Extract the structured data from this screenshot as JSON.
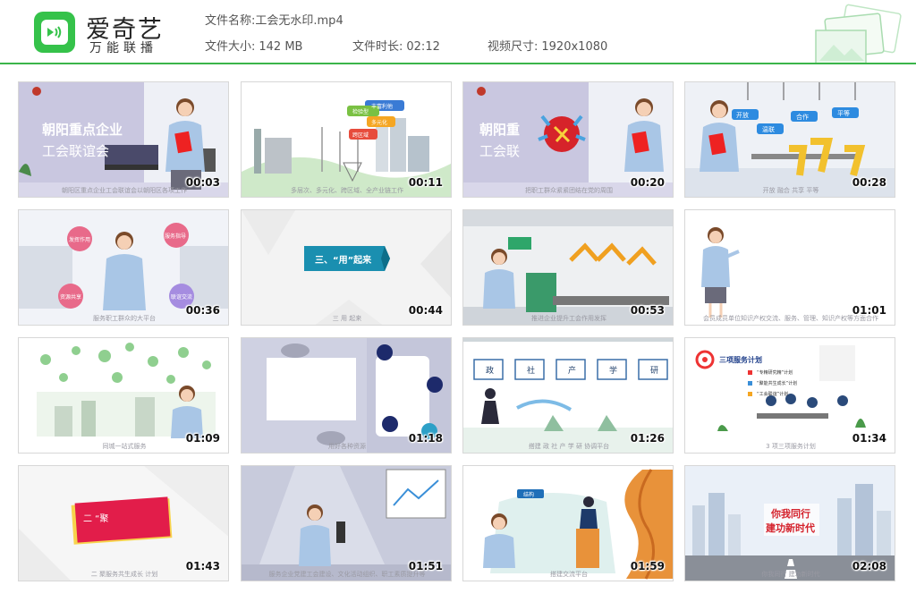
{
  "brand": {
    "name": "爱奇艺",
    "sub": "万能联播",
    "colors": {
      "accent": "#3bb54a",
      "logo": "#35c24a"
    }
  },
  "file": {
    "name_label": "文件名称:",
    "name_value": "工会无水印.mp4",
    "size_label": "文件大小:",
    "size_value": "142 MB",
    "duration_label": "文件时长:",
    "duration_value": "02:12",
    "dims_label": "视频尺寸:",
    "dims_value": "1920x1080"
  },
  "thumbs": [
    {
      "time": "00:03",
      "caption": "朝阳区重点企业工会联谊会以朝阳区各项工作",
      "texts": [
        "朝阳重点企业",
        "工会联谊会"
      ]
    },
    {
      "time": "00:11",
      "caption": "多层次、多元化、跨区域、全产业链工作",
      "texts": [
        "丰富利他",
        "检验型",
        "多元化",
        "跨区域"
      ]
    },
    {
      "time": "00:20",
      "caption": "把职工群众紧紧团结在党的周围",
      "texts": [
        "朝阳重",
        "工会联"
      ]
    },
    {
      "time": "00:28",
      "caption": "开放 融合 共享 平等",
      "texts": [
        "开放",
        "合作",
        "平等",
        "温联"
      ]
    },
    {
      "time": "00:36",
      "caption": "服务职工群众的大平台",
      "texts": [
        "发挥作用",
        "服务指导",
        "资源共享",
        "联谊交流"
      ]
    },
    {
      "time": "00:44",
      "caption": "三 用 起来",
      "texts": [
        "三、“用”起来"
      ]
    },
    {
      "time": "00:53",
      "caption": "推进企业提升工会作用发挥",
      "texts": []
    },
    {
      "time": "01:01",
      "caption": "会员成员单位知识产权交流、服务、管理、知识产权等方面合作",
      "texts": []
    },
    {
      "time": "01:09",
      "caption": "同城一站式服务",
      "texts": []
    },
    {
      "time": "01:18",
      "caption": "用好各种资源",
      "texts": []
    },
    {
      "time": "01:26",
      "caption": "搭建 政 社 产 学 研 协调平台",
      "texts": [
        "政",
        "社",
        "产",
        "学",
        "研"
      ]
    },
    {
      "time": "01:34",
      "caption": "3 项三项服务计划",
      "texts": [
        "三项服务计划",
        "“专精研究精”计划",
        "“聚能共生成长”计划",
        "“工会联谊”计划"
      ]
    },
    {
      "time": "01:43",
      "caption": "二 聚服务共生成长 计划",
      "texts": [
        "二 “聚"
      ]
    },
    {
      "time": "01:51",
      "caption": "服务企业党建工会建设、文化活动组织、职工素质提升等",
      "texts": []
    },
    {
      "time": "01:59",
      "caption": "搭建交流平台",
      "texts": [
        "结构"
      ]
    },
    {
      "time": "02:08",
      "caption": "你我同行 建功新时代",
      "texts": [
        "你我同行",
        "建功新时代"
      ]
    }
  ]
}
